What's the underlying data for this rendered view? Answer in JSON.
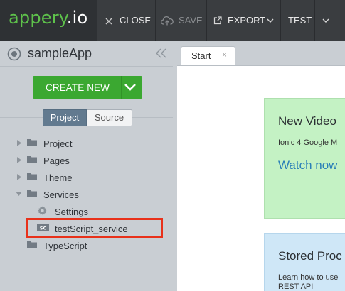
{
  "header": {
    "logo_prefix": "appery",
    "logo_suffix": ".io",
    "close_label": "CLOSE",
    "save_label": "SAVE",
    "export_label": "EXPORT",
    "test_label": "TEST"
  },
  "sidebar": {
    "app_name": "sampleApp",
    "create_new_label": "CREATE NEW",
    "tabs": {
      "project": "Project",
      "source": "Source"
    },
    "tree": [
      {
        "label": "Project",
        "icon": "folder-icon",
        "expander": "collapsed"
      },
      {
        "label": "Pages",
        "icon": "folder-icon",
        "expander": "collapsed"
      },
      {
        "label": "Theme",
        "icon": "folder-icon",
        "expander": "collapsed"
      },
      {
        "label": "Services",
        "icon": "folder-icon",
        "expander": "expanded"
      },
      {
        "label": "Settings",
        "icon": "gear-icon"
      },
      {
        "label": "testScript_service",
        "icon": "service-icon",
        "badge": "SC",
        "highlighted": true
      },
      {
        "label": "TypeScript",
        "icon": "folder-icon"
      }
    ]
  },
  "editor": {
    "tab_label": "Start",
    "tab_close": "×",
    "video_card": {
      "heading": "New Video",
      "text": "Ionic 4 Google M",
      "link": "Watch now"
    },
    "stored_card": {
      "heading": "Stored Proc",
      "text_line1": "Learn how to use",
      "text_line2": "REST API"
    }
  },
  "colors": {
    "brand_green": "#5ec24b",
    "create_button": "#3ba831",
    "highlight": "#e8311a",
    "link": "#2a7fb8",
    "video_card_bg": "#c4f2c4",
    "stored_card_bg": "#cfe7f7"
  }
}
